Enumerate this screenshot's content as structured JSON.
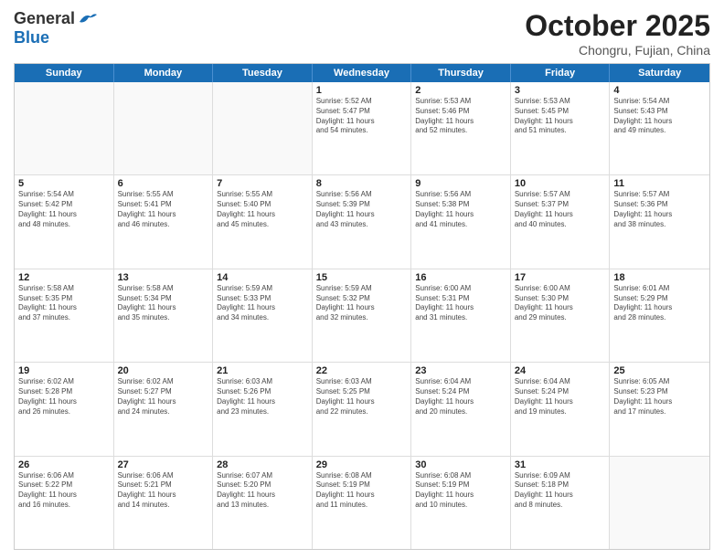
{
  "header": {
    "logo_general": "General",
    "logo_blue": "Blue",
    "title": "October 2025",
    "location": "Chongru, Fujian, China"
  },
  "weekdays": [
    "Sunday",
    "Monday",
    "Tuesday",
    "Wednesday",
    "Thursday",
    "Friday",
    "Saturday"
  ],
  "rows": [
    [
      {
        "day": "",
        "text": ""
      },
      {
        "day": "",
        "text": ""
      },
      {
        "day": "",
        "text": ""
      },
      {
        "day": "1",
        "text": "Sunrise: 5:52 AM\nSunset: 5:47 PM\nDaylight: 11 hours\nand 54 minutes."
      },
      {
        "day": "2",
        "text": "Sunrise: 5:53 AM\nSunset: 5:46 PM\nDaylight: 11 hours\nand 52 minutes."
      },
      {
        "day": "3",
        "text": "Sunrise: 5:53 AM\nSunset: 5:45 PM\nDaylight: 11 hours\nand 51 minutes."
      },
      {
        "day": "4",
        "text": "Sunrise: 5:54 AM\nSunset: 5:43 PM\nDaylight: 11 hours\nand 49 minutes."
      }
    ],
    [
      {
        "day": "5",
        "text": "Sunrise: 5:54 AM\nSunset: 5:42 PM\nDaylight: 11 hours\nand 48 minutes."
      },
      {
        "day": "6",
        "text": "Sunrise: 5:55 AM\nSunset: 5:41 PM\nDaylight: 11 hours\nand 46 minutes."
      },
      {
        "day": "7",
        "text": "Sunrise: 5:55 AM\nSunset: 5:40 PM\nDaylight: 11 hours\nand 45 minutes."
      },
      {
        "day": "8",
        "text": "Sunrise: 5:56 AM\nSunset: 5:39 PM\nDaylight: 11 hours\nand 43 minutes."
      },
      {
        "day": "9",
        "text": "Sunrise: 5:56 AM\nSunset: 5:38 PM\nDaylight: 11 hours\nand 41 minutes."
      },
      {
        "day": "10",
        "text": "Sunrise: 5:57 AM\nSunset: 5:37 PM\nDaylight: 11 hours\nand 40 minutes."
      },
      {
        "day": "11",
        "text": "Sunrise: 5:57 AM\nSunset: 5:36 PM\nDaylight: 11 hours\nand 38 minutes."
      }
    ],
    [
      {
        "day": "12",
        "text": "Sunrise: 5:58 AM\nSunset: 5:35 PM\nDaylight: 11 hours\nand 37 minutes."
      },
      {
        "day": "13",
        "text": "Sunrise: 5:58 AM\nSunset: 5:34 PM\nDaylight: 11 hours\nand 35 minutes."
      },
      {
        "day": "14",
        "text": "Sunrise: 5:59 AM\nSunset: 5:33 PM\nDaylight: 11 hours\nand 34 minutes."
      },
      {
        "day": "15",
        "text": "Sunrise: 5:59 AM\nSunset: 5:32 PM\nDaylight: 11 hours\nand 32 minutes."
      },
      {
        "day": "16",
        "text": "Sunrise: 6:00 AM\nSunset: 5:31 PM\nDaylight: 11 hours\nand 31 minutes."
      },
      {
        "day": "17",
        "text": "Sunrise: 6:00 AM\nSunset: 5:30 PM\nDaylight: 11 hours\nand 29 minutes."
      },
      {
        "day": "18",
        "text": "Sunrise: 6:01 AM\nSunset: 5:29 PM\nDaylight: 11 hours\nand 28 minutes."
      }
    ],
    [
      {
        "day": "19",
        "text": "Sunrise: 6:02 AM\nSunset: 5:28 PM\nDaylight: 11 hours\nand 26 minutes."
      },
      {
        "day": "20",
        "text": "Sunrise: 6:02 AM\nSunset: 5:27 PM\nDaylight: 11 hours\nand 24 minutes."
      },
      {
        "day": "21",
        "text": "Sunrise: 6:03 AM\nSunset: 5:26 PM\nDaylight: 11 hours\nand 23 minutes."
      },
      {
        "day": "22",
        "text": "Sunrise: 6:03 AM\nSunset: 5:25 PM\nDaylight: 11 hours\nand 22 minutes."
      },
      {
        "day": "23",
        "text": "Sunrise: 6:04 AM\nSunset: 5:24 PM\nDaylight: 11 hours\nand 20 minutes."
      },
      {
        "day": "24",
        "text": "Sunrise: 6:04 AM\nSunset: 5:24 PM\nDaylight: 11 hours\nand 19 minutes."
      },
      {
        "day": "25",
        "text": "Sunrise: 6:05 AM\nSunset: 5:23 PM\nDaylight: 11 hours\nand 17 minutes."
      }
    ],
    [
      {
        "day": "26",
        "text": "Sunrise: 6:06 AM\nSunset: 5:22 PM\nDaylight: 11 hours\nand 16 minutes."
      },
      {
        "day": "27",
        "text": "Sunrise: 6:06 AM\nSunset: 5:21 PM\nDaylight: 11 hours\nand 14 minutes."
      },
      {
        "day": "28",
        "text": "Sunrise: 6:07 AM\nSunset: 5:20 PM\nDaylight: 11 hours\nand 13 minutes."
      },
      {
        "day": "29",
        "text": "Sunrise: 6:08 AM\nSunset: 5:19 PM\nDaylight: 11 hours\nand 11 minutes."
      },
      {
        "day": "30",
        "text": "Sunrise: 6:08 AM\nSunset: 5:19 PM\nDaylight: 11 hours\nand 10 minutes."
      },
      {
        "day": "31",
        "text": "Sunrise: 6:09 AM\nSunset: 5:18 PM\nDaylight: 11 hours\nand 8 minutes."
      },
      {
        "day": "",
        "text": ""
      }
    ]
  ]
}
